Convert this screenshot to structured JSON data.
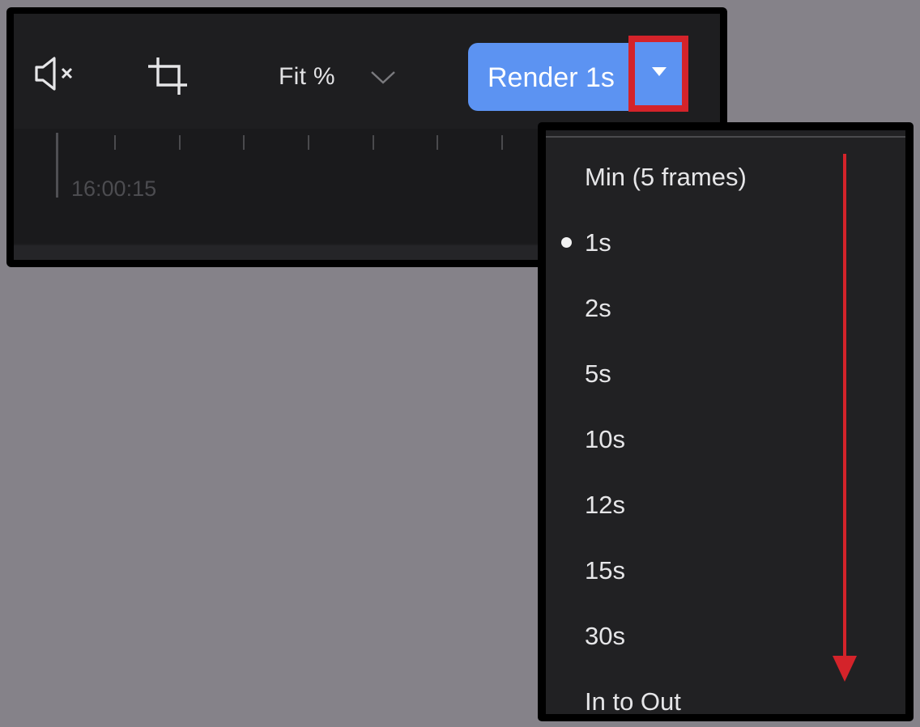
{
  "toolbar": {
    "mute_icon": "speaker-muted-icon",
    "crop_icon": "crop-icon",
    "fit_label": "Fit %",
    "fit_chevron_icon": "chevron-down-icon",
    "render_label": "Render 1s",
    "render_dropdown_icon": "caret-down-icon"
  },
  "timeline": {
    "timecode": "16:00:15"
  },
  "render_menu": {
    "items": [
      {
        "label": "Min (5 frames)",
        "selected": false
      },
      {
        "label": "1s",
        "selected": true
      },
      {
        "label": "2s",
        "selected": false
      },
      {
        "label": "5s",
        "selected": false
      },
      {
        "label": "10s",
        "selected": false
      },
      {
        "label": "12s",
        "selected": false
      },
      {
        "label": "15s",
        "selected": false
      },
      {
        "label": "30s",
        "selected": false
      },
      {
        "label": "In to Out",
        "selected": false
      }
    ]
  },
  "colors": {
    "background": "#858289",
    "panel": "#1e1e20",
    "accent_blue": "#5c93f2",
    "highlight_red": "#d4232a",
    "menu": "#212123",
    "text": "#e6e6e8"
  }
}
